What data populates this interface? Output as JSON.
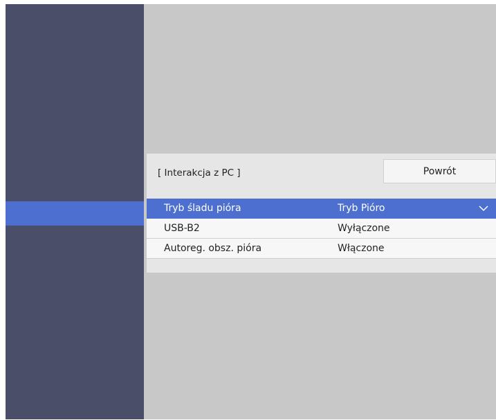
{
  "panel": {
    "title": "[ Interakcja z PC ]",
    "back_label": "Powrót"
  },
  "rows": [
    {
      "label": "Tryb śladu pióra",
      "value": "Tryb Pióro",
      "selected": true
    },
    {
      "label": "USB-B2",
      "value": "Wyłączone",
      "selected": false
    },
    {
      "label": "Autoreg. obsz. pióra",
      "value": "Włączone",
      "selected": false
    }
  ],
  "colors": {
    "sidebar": "#4a4e69",
    "highlight": "#4d6fd0",
    "background": "#c8c8c8",
    "panel": "#e6e6e6"
  },
  "icons": {
    "dropdown": "chevron-down-icon"
  }
}
